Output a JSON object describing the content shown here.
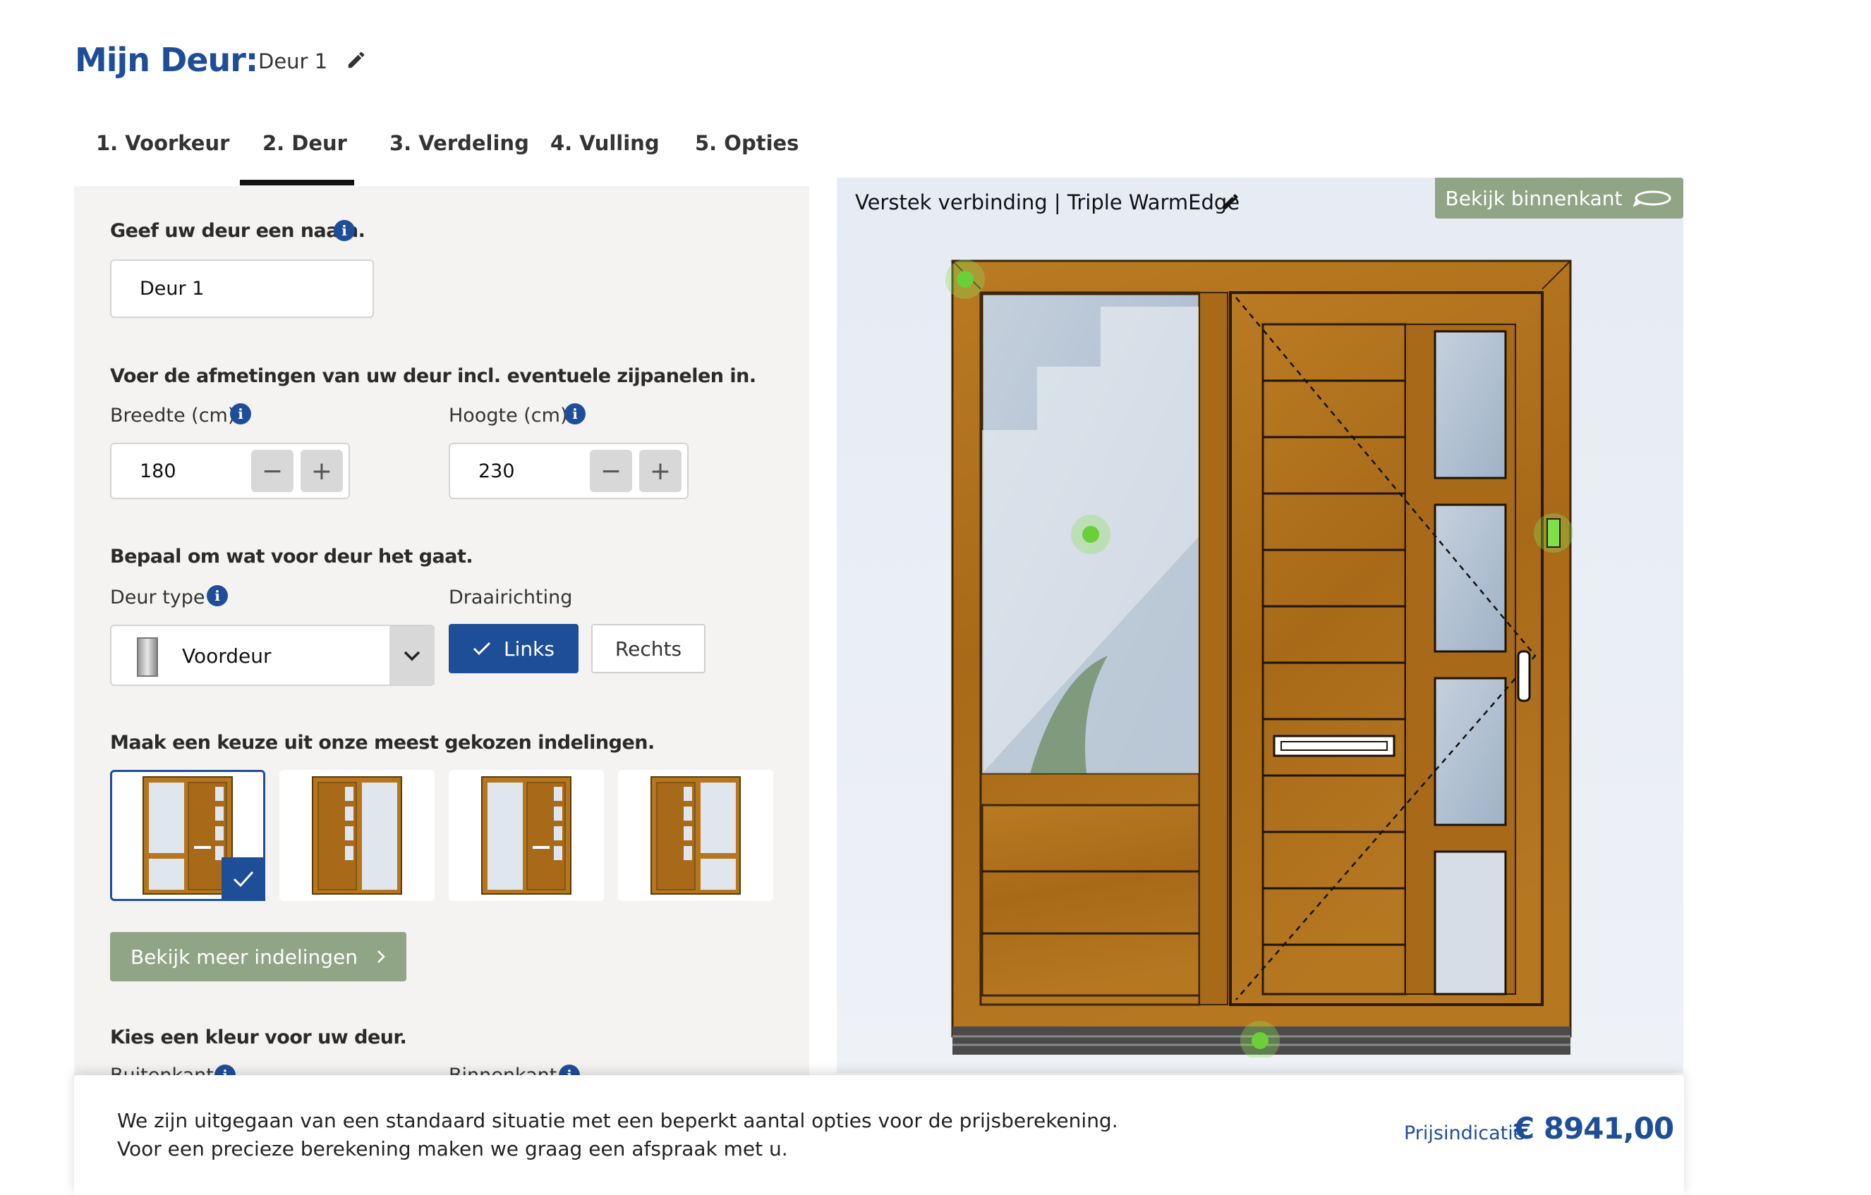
{
  "header": {
    "title": "Mijn Deur:",
    "door_name": "Deur 1"
  },
  "tabs": [
    {
      "label": "1. Voorkeur"
    },
    {
      "label": "2. Deur"
    },
    {
      "label": "3. Verdeling"
    },
    {
      "label": "4. Vulling"
    },
    {
      "label": "5. Opties"
    }
  ],
  "active_tab": "2. Deur",
  "form": {
    "name_label": "Geef uw deur een naam.",
    "name_value": "Deur 1",
    "dimensions_label": "Voer de afmetingen van uw deur incl. eventuele zijpanelen in.",
    "width_label": "Breedte (cm)",
    "width_value": "180",
    "height_label": "Hoogte (cm)",
    "height_value": "230",
    "minus": "−",
    "plus": "+",
    "type_section_label": "Bepaal om wat voor deur het gaat.",
    "door_type_label": "Deur type",
    "door_type_value": "Voordeur",
    "swing_label": "Draairichting",
    "swing_left": "Links",
    "swing_right": "Rechts",
    "swing_selected": "Links",
    "layouts_label": "Maak een keuze uit onze meest gekozen indelingen.",
    "layouts_selected_index": 0,
    "more_layouts": "Bekijk meer indelingen",
    "color_label": "Kies een kleur voor uw deur.",
    "outside_label": "Buitenkant",
    "inside_label": "Binnenkant"
  },
  "preview": {
    "glazing": "Verstek verbinding | Triple WarmEdge",
    "view_inside": "Bekijk binnenkant"
  },
  "footer": {
    "note_line1": "We zijn uitgegaan van een standaard situatie met een beperkt aantal opties voor de prijsberekening.",
    "note_line2": "Voor een precieze berekening maken we graag een afspraak met u.",
    "price_label": "Prijsindicatie",
    "price_value": "€ 8941,00"
  },
  "colors": {
    "accent": "#1f4e99",
    "green_button": "#8fa585",
    "wood": "#b0731f"
  }
}
